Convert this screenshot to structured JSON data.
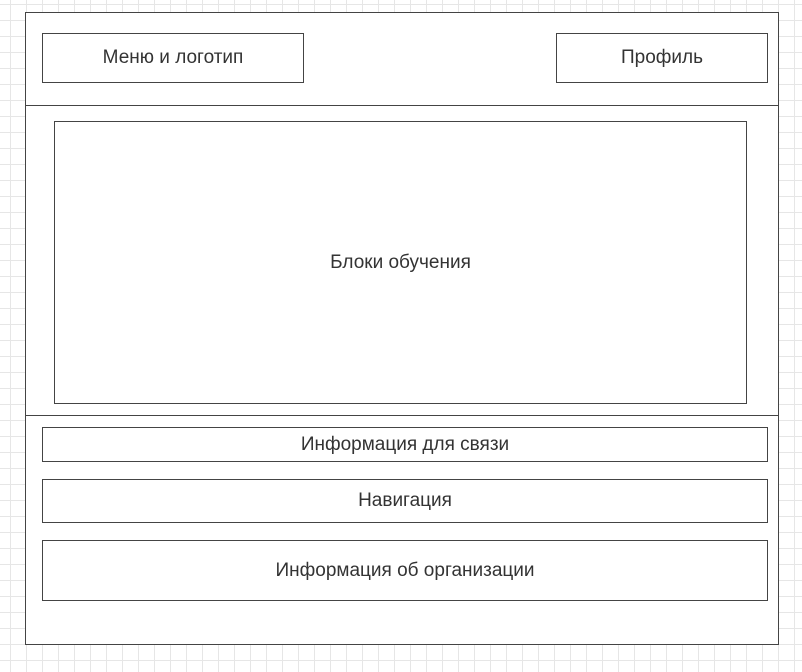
{
  "header": {
    "menu_logo_label": "Меню и логотип",
    "profile_label": "Профиль"
  },
  "main": {
    "learning_blocks_label": "Блоки обучения"
  },
  "footer": {
    "contact_info_label": "Информация для связи",
    "navigation_label": "Навигация",
    "organization_info_label": "Информация об организации"
  }
}
